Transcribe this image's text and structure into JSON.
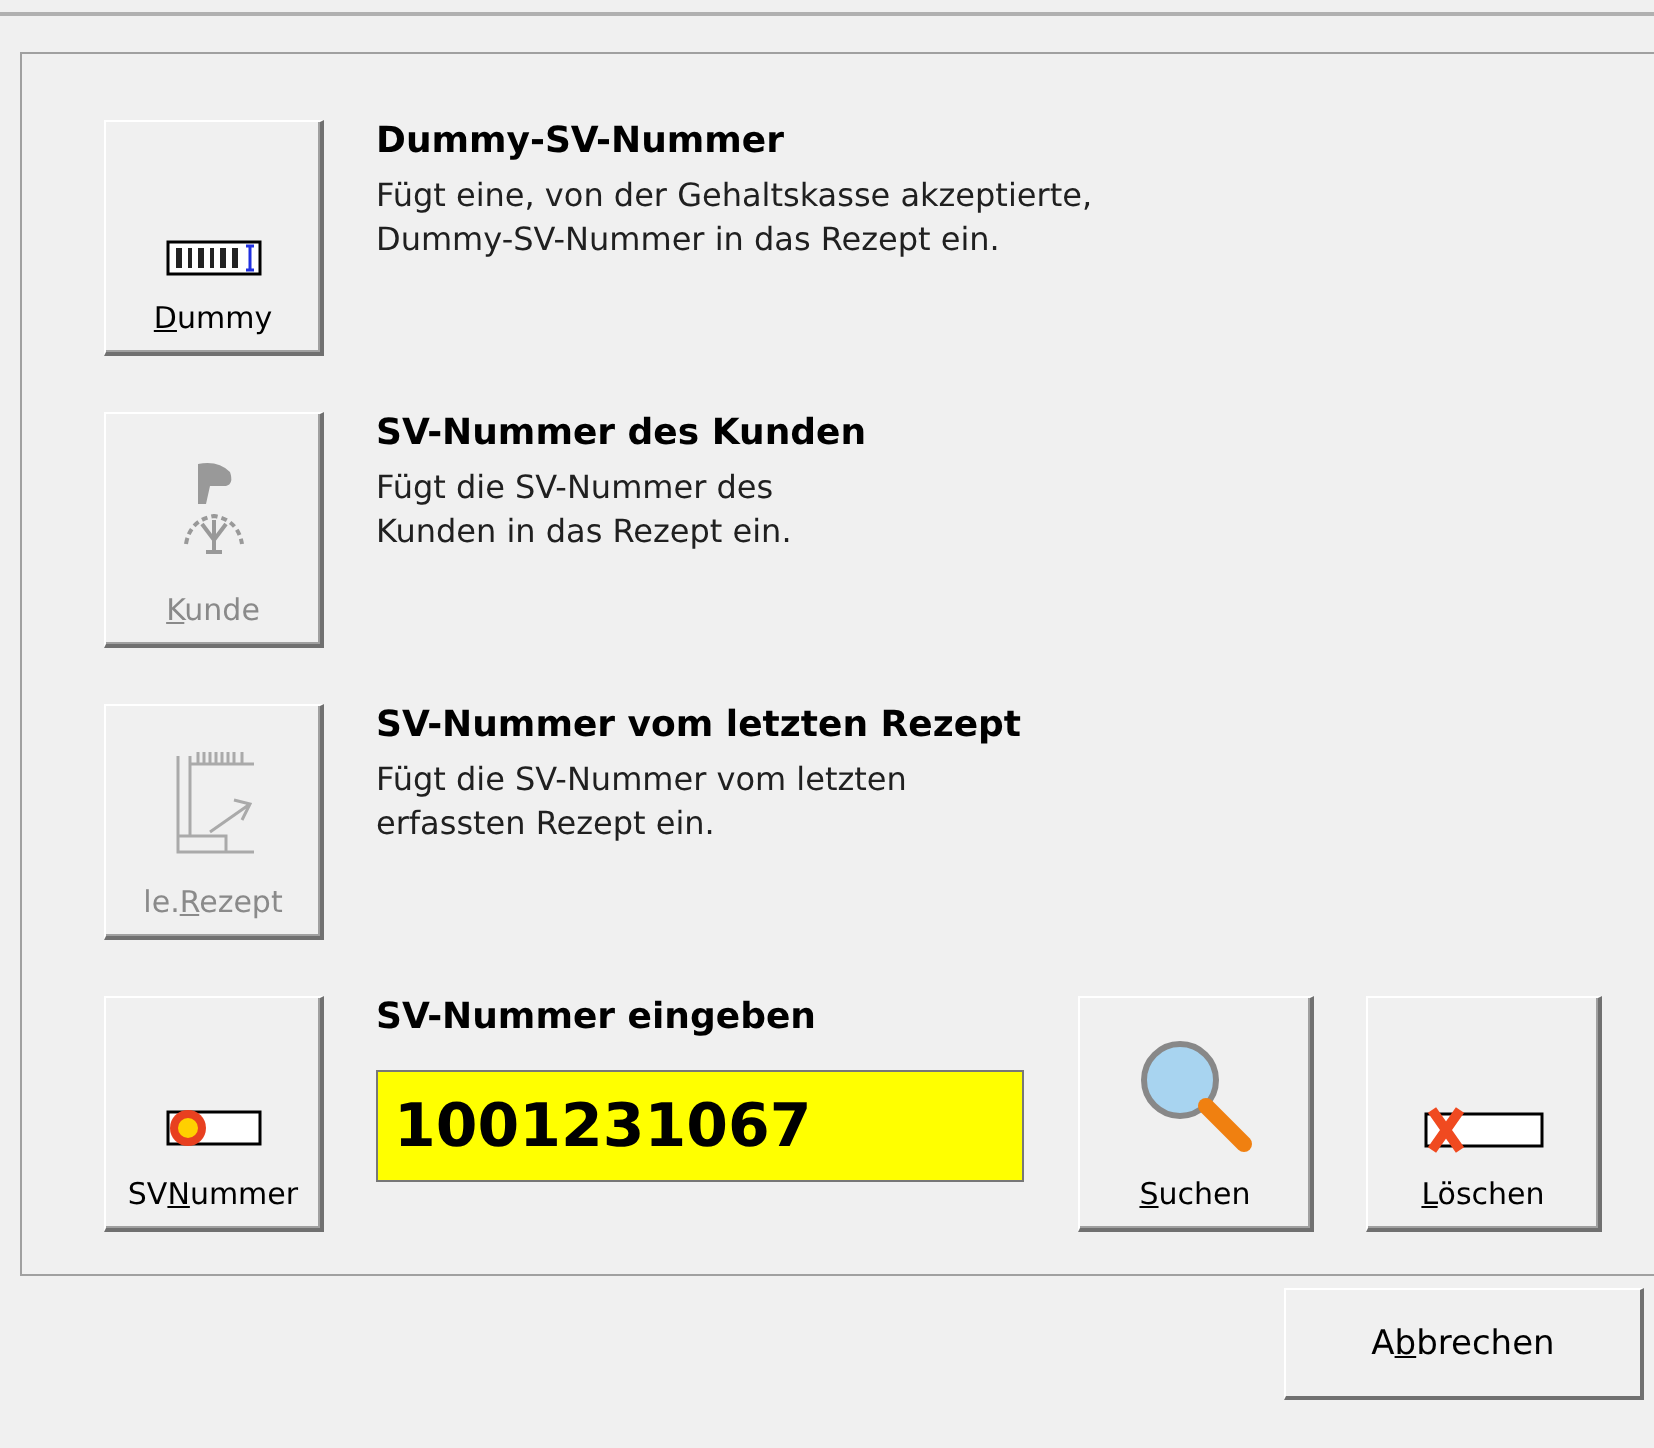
{
  "options": [
    {
      "kind": "dummy",
      "button": {
        "key": "D",
        "post": "ummy",
        "disabled": false
      },
      "title": "Dummy-SV-Nummer",
      "description": "Fügt eine, von der Gehaltskasse akzeptierte, Dummy-SV-Nummer in das Rezept ein."
    },
    {
      "kind": "customer",
      "button": {
        "key": "K",
        "post": "unde",
        "disabled": true
      },
      "title": "SV-Nummer des Kunden",
      "description": "Fügt die SV-Nummer des Kunden in das Rezept ein."
    },
    {
      "kind": "last",
      "button": {
        "pre": "le.",
        "key": "R",
        "post": "ezept",
        "disabled": true
      },
      "title": "SV-Nummer vom letzten Rezept",
      "description": "Fügt die SV-Nummer vom letzten erfassten Rezept ein."
    }
  ],
  "entry": {
    "button": {
      "pre": "SV",
      "key": "N",
      "post": "ummer",
      "disabled": false
    },
    "title": "SV-Nummer eingeben",
    "value": "1001231067",
    "search_button": {
      "key": "S",
      "post": "uchen",
      "disabled": false
    },
    "clear_button": {
      "key": "L",
      "post": "öschen",
      "disabled": false
    }
  },
  "cancel_button": {
    "pre": "A",
    "key": "b",
    "post": "brechen",
    "disabled": false
  }
}
